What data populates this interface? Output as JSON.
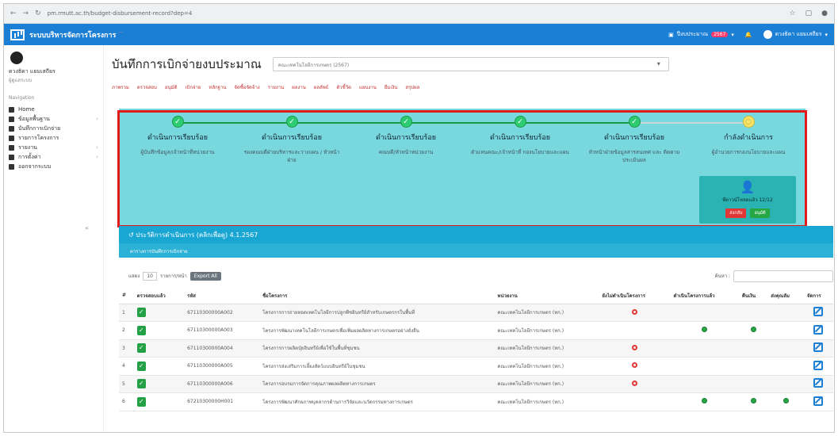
{
  "browser": {
    "url": "pm.rmutt.ac.th/budget-disbursement-record?dep=4"
  },
  "app": {
    "title": "ระบบบริหารจัดการโครงการ",
    "badge": "...",
    "topbar_items": [
      "ปีงบประมาณ",
      "2567",
      "ดวงธิดา แยมเสถียร"
    ],
    "accent": "#1c7fd6"
  },
  "sidebar": {
    "user_name": "ดวงธิดา แยมเสถียร",
    "user_role": "ผู้ดูแลระบบ",
    "nav_label": "Navigation",
    "items": [
      {
        "label": "Home",
        "icon": "grid-icon"
      },
      {
        "label": "ข้อมูลพื้นฐาน",
        "icon": "folder-icon"
      },
      {
        "label": "บันทึกการเบิกจ่าย",
        "icon": "table-icon"
      },
      {
        "label": "รายการโครงการ",
        "icon": "list-icon"
      },
      {
        "label": "รายงาน",
        "icon": "file-icon"
      },
      {
        "label": "การตั้งค่า",
        "icon": "settings-icon"
      },
      {
        "label": "ออกจากระบบ",
        "icon": "user-icon"
      }
    ]
  },
  "page": {
    "title": "บันทึกการเบิกจ่ายงบประมาณ",
    "select_value": "คณะเทคโนโลยีการเกษตร (2567)",
    "menu_links": [
      "ภาพรวม",
      "ตรวจสอบ",
      "อนุมัติ",
      "เบิกจ่าย",
      "หลักฐาน",
      "จัดซื้อจัดจ้าง",
      "รายงาน",
      "ผลงาน",
      "ผลลัพธ์",
      "ตัวชี้วัด",
      "แผนงาน",
      "ยืมเงิน",
      "สรุปผล"
    ]
  },
  "workflow": {
    "steps": [
      {
        "status": "ดำเนินการเรียบร้อย",
        "desc": "ผู้บันทึกข้อมูล/เจ้าหน้าที่หน่วยงาน",
        "state": "done"
      },
      {
        "status": "ดำเนินการเรียบร้อย",
        "desc": "รองคณบดีฝ่ายบริหารและวางแผน / หัวหน้าฝ่าย",
        "state": "done"
      },
      {
        "status": "ดำเนินการเรียบร้อย",
        "desc": "คณบดี/หัวหน้าหน่วยงาน",
        "state": "done"
      },
      {
        "status": "ดำเนินการเรียบร้อย",
        "desc": "ตัวแทนคณะ/เจ้าหน้าที่ กองนโยบายและแผน",
        "state": "done"
      },
      {
        "status": "ดำเนินการเรียบร้อย",
        "desc": "หัวหน้าฝ่ายข้อมูลสารสนเทศ และ ติดตามประเมินผล",
        "state": "done"
      },
      {
        "status": "กำลังดำเนินการ",
        "desc": "ผู้อำนวยการกองนโยบายและแผน",
        "state": "pending"
      }
    ],
    "card": {
      "count_text": "ที่ดาวน์โหลดแล้ว 12/12",
      "reject_label": "ส่งกลับ",
      "approve_label": "อนุมัติ"
    }
  },
  "history": {
    "header": "ประวัติการดำเนินการ (คลิกเพื่อดู) 4.1.2567",
    "sub": "ตารางการบันทึกการเบิกจ่าย",
    "show_label": "แสดง",
    "page_size": "10",
    "items_label": "รายการ/หน้า",
    "export_label": "Export All",
    "search_label": "ค้นหา :"
  },
  "table": {
    "columns": [
      "#",
      "ตรวจสอบแล้ว",
      "รหัส",
      "ชื่อโครงการ",
      "หน่วยงาน",
      "ยังไม่ดำเนินโครงการ",
      "ดำเนินโครงการแล้ว",
      "คืนเงิน",
      "ส่งคุณลัม",
      "จัดการ"
    ],
    "rows": [
      {
        "no": "1",
        "code": "67110300000A002",
        "name": "โครงการการถ่ายทอดเทคโนโลยีการปลูกพืชอินทรีย์สำหรับเกษตรกรในพื้นที่",
        "dept": "คณะเทคโนโลยีการเกษตร (ทก.)",
        "notstarted": true,
        "done": false,
        "refund": false,
        "sent": false
      },
      {
        "no": "2",
        "code": "67110300000A003",
        "name": "โครงการพัฒนาเทคโนโลยีการเกษตรเพื่อเพิ่มผลผลิตทางการเกษตรอย่างยั่งยืน",
        "dept": "คณะเทคโนโลยีการเกษตร (ทก.)",
        "notstarted": false,
        "done": true,
        "refund": true,
        "sent": false
      },
      {
        "no": "3",
        "code": "67110300000A004",
        "name": "โครงการการผลิตปุ๋ยอินทรีย์เพื่อใช้ในพื้นที่ชุมชน",
        "dept": "คณะเทคโนโลยีการเกษตร (ทก.)",
        "notstarted": true,
        "done": false,
        "refund": false,
        "sent": false
      },
      {
        "no": "4",
        "code": "67110300000A005",
        "name": "โครงการส่งเสริมการเลี้ยงสัตว์แบบอินทรีย์ในชุมชน",
        "dept": "คณะเทคโนโลยีการเกษตร (ทก.)",
        "notstarted": true,
        "done": false,
        "refund": false,
        "sent": false
      },
      {
        "no": "5",
        "code": "67110300000A006",
        "name": "โครงการอบรมการจัดการคุณภาพผลผลิตทางการเกษตร",
        "dept": "คณะเทคโนโลยีการเกษตร (ทก.)",
        "notstarted": true,
        "done": false,
        "refund": false,
        "sent": false
      },
      {
        "no": "6",
        "code": "67210300000H001",
        "name": "โครงการพัฒนาศักยภาพบุคลากรด้านการวิจัยและนวัตกรรมทางการเกษตร",
        "dept": "คณะเทคโนโลยีการเกษตร (ทก.)",
        "notstarted": false,
        "done": true,
        "refund": true,
        "sent": true
      }
    ]
  }
}
